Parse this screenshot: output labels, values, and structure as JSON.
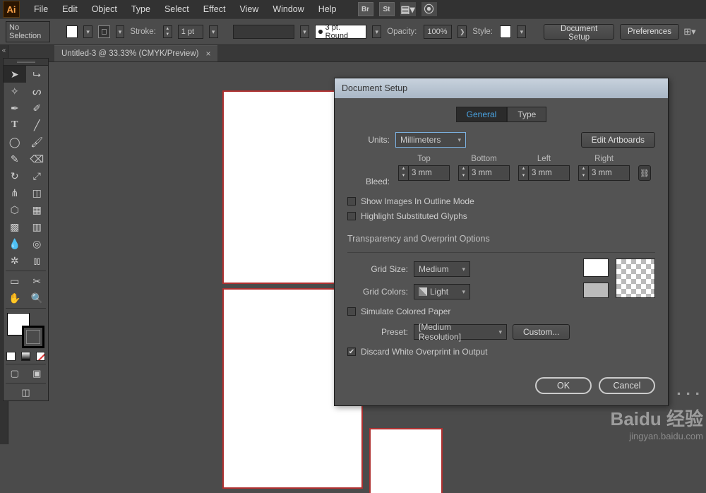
{
  "menubar": {
    "items": [
      "File",
      "Edit",
      "Object",
      "Type",
      "Select",
      "Effect",
      "View",
      "Window",
      "Help"
    ],
    "right_icons": [
      "Br",
      "St"
    ]
  },
  "controlbar": {
    "selection": "No Selection",
    "stroke_label": "Stroke:",
    "stroke_value": "1 pt",
    "brush": "3 pt. Round",
    "opacity_label": "Opacity:",
    "opacity_value": "100%",
    "style_label": "Style:",
    "btn_docsetup": "Document Setup",
    "btn_prefs": "Preferences"
  },
  "tab": {
    "title": "Untitled-3 @ 33.33% (CMYK/Preview)"
  },
  "dialog": {
    "title": "Document Setup",
    "tabs": {
      "general": "General",
      "type": "Type"
    },
    "units_label": "Units:",
    "units_value": "Millimeters",
    "edit_artboards": "Edit Artboards",
    "bleed_label": "Bleed:",
    "bleed": {
      "top_label": "Top",
      "top": "3 mm",
      "bottom_label": "Bottom",
      "bottom": "3 mm",
      "left_label": "Left",
      "left": "3 mm",
      "right_label": "Right",
      "right": "3 mm"
    },
    "ck_show_images": "Show Images In Outline Mode",
    "ck_highlight_glyphs": "Highlight Substituted Glyphs",
    "section_trans": "Transparency and Overprint Options",
    "grid_size_label": "Grid Size:",
    "grid_size_value": "Medium",
    "grid_colors_label": "Grid Colors:",
    "grid_colors_value": "Light",
    "ck_simulate_paper": "Simulate Colored Paper",
    "preset_label": "Preset:",
    "preset_value": "[Medium Resolution]",
    "custom_btn": "Custom...",
    "ck_discard_white": "Discard White Overprint in Output",
    "ok": "OK",
    "cancel": "Cancel"
  },
  "watermark": {
    "line1": "Baidu 经验",
    "line2": "jingyan.baidu.com"
  }
}
